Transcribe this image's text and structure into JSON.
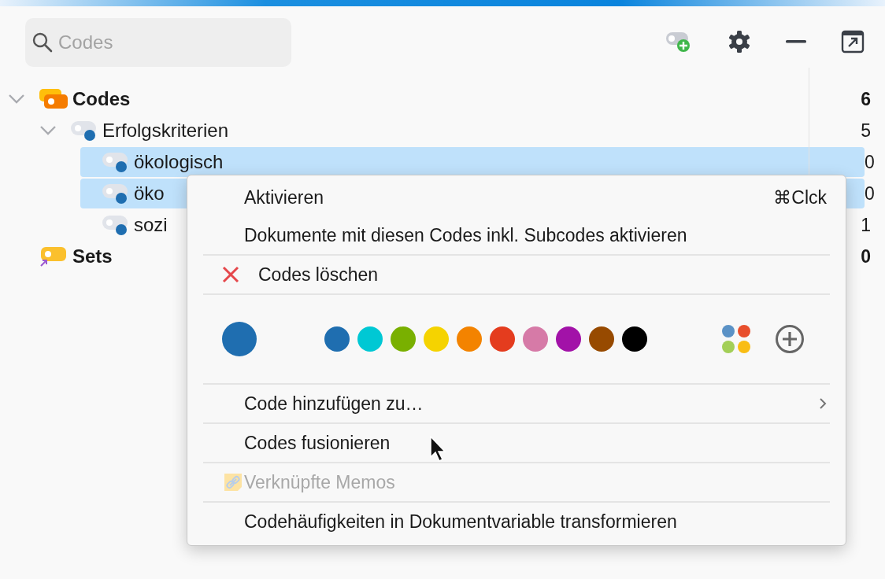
{
  "search": {
    "placeholder": "Codes"
  },
  "tree": [
    {
      "label": "Codes",
      "kind": "root",
      "count": "6",
      "expanded": true,
      "selected": false,
      "children": [
        {
          "label": "Erfolgskriterien",
          "kind": "code",
          "count": "5",
          "expanded": true,
          "selected": false,
          "children": [
            {
              "label": "ökologisch",
              "kind": "code",
              "count": "0",
              "selected": true
            },
            {
              "label": "öko",
              "kind": "code",
              "count": "0",
              "selected": true
            },
            {
              "label": "sozi",
              "kind": "code",
              "count": "1",
              "selected": false
            }
          ]
        }
      ]
    },
    {
      "label": "Sets",
      "kind": "sets",
      "count": "0",
      "selected": false
    }
  ],
  "menu": [
    [
      {
        "kind": "item",
        "label": "Aktivieren",
        "shortcut": "⌘Clck"
      },
      {
        "kind": "item",
        "label": "Dokumente mit diesen Codes inkl. Subcodes aktivieren"
      }
    ],
    [
      {
        "kind": "delete",
        "label": "Codes löschen"
      }
    ],
    [
      {
        "kind": "colors",
        "current": {
          "color": "#1f6eb0"
        },
        "colors": [
          {
            "color": "#1f6eb0"
          },
          {
            "color": "#00c8d4"
          },
          {
            "color": "#79b000"
          },
          {
            "color": "#f5d300"
          },
          {
            "color": "#f38300"
          },
          {
            "color": "#e43c1e"
          },
          {
            "color": "#d67aa7"
          },
          {
            "color": "#a212a8"
          },
          {
            "color": "#974a00"
          },
          {
            "color": "#000000"
          }
        ]
      }
    ],
    [
      {
        "kind": "submenu",
        "label": "Code hinzufügen zu…"
      }
    ],
    [
      {
        "kind": "item",
        "label": "Codes fusionieren"
      }
    ],
    [
      {
        "kind": "memo",
        "label": "Verknüpfte Memos",
        "disabled": true
      }
    ],
    [
      {
        "kind": "item",
        "label": "Codehäufigkeiten in Dokumentvariable transformieren"
      }
    ]
  ]
}
